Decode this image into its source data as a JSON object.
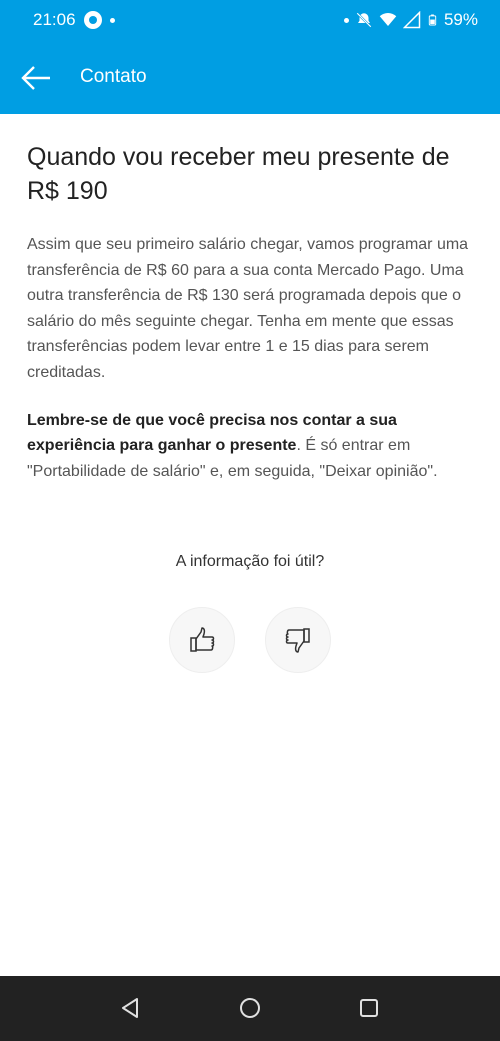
{
  "status_bar": {
    "time": "21:06",
    "battery": "59%",
    "icons": [
      "whatsapp-icon",
      "notification-dot",
      "mute-icon",
      "wifi-icon",
      "signal-icon",
      "battery-icon"
    ]
  },
  "app_bar": {
    "back_icon": "arrow-left-icon",
    "title": "Contato"
  },
  "article": {
    "title": "Quando vou receber meu presente de R$ 190",
    "paragraph1": "Assim que seu primeiro salário chegar, vamos programar uma transferência de R$ 60 para a sua conta Mercado Pago. Uma outra transferência de R$ 130 será programada depois que o salário do mês seguinte chegar. Tenha em mente que essas transferências podem levar entre 1 e 15 dias para serem creditadas.",
    "paragraph2_bold": "Lembre-se de que você precisa nos contar a sua experiência para ganhar o presente",
    "paragraph2_rest": ". É só entrar em \"Portabilidade de salário\" e, em seguida, \"Deixar opinião\"."
  },
  "feedback": {
    "question": "A informação foi útil?",
    "thumbs_up_icon": "thumbs-up-icon",
    "thumbs_down_icon": "thumbs-down-icon"
  },
  "nav_bar": {
    "icons": [
      "nav-back-icon",
      "nav-home-icon",
      "nav-recents-icon"
    ]
  },
  "colors": {
    "brand_blue": "#009ee3",
    "nav_dark": "#222222"
  }
}
